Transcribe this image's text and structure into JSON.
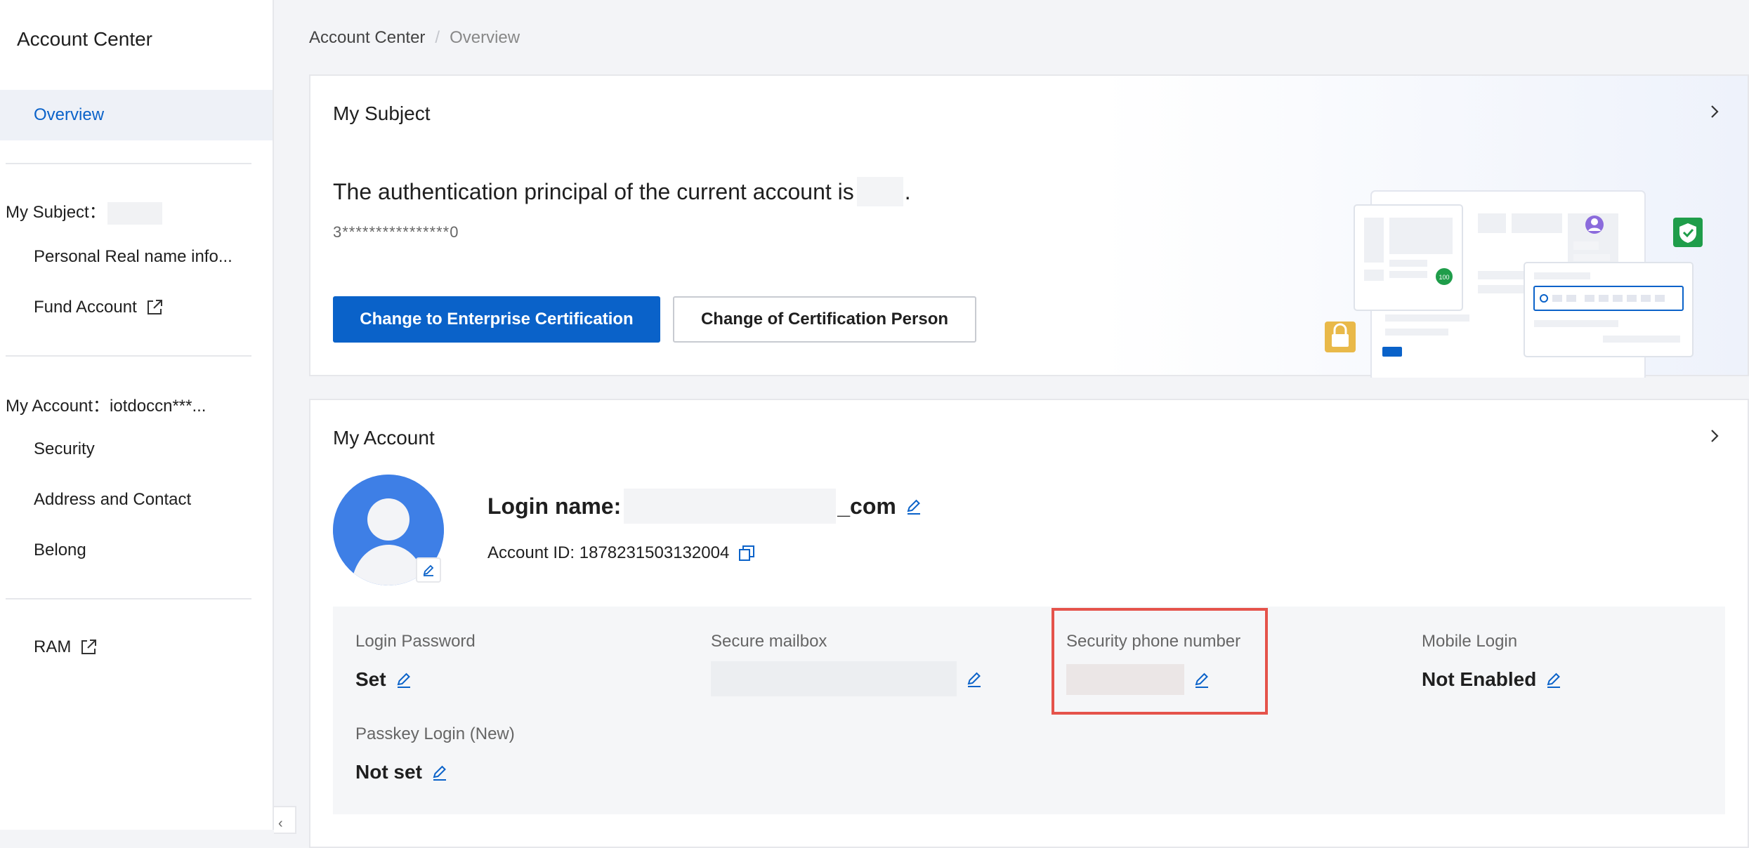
{
  "sidebar": {
    "title": "Account Center",
    "active_item": "Overview",
    "subject_group": "My Subject：",
    "subject_items": [
      "Personal Real name info...",
      "Fund Account"
    ],
    "account_group": "My Account：iotdoccn***...",
    "account_items": [
      "Security",
      "Address and Contact",
      "Belong"
    ],
    "ram_label": "RAM",
    "collapse_glyph": "‹"
  },
  "breadcrumb": {
    "root": "Account Center",
    "separator": "/",
    "current": "Overview"
  },
  "subject_card": {
    "title": "My Subject",
    "principal_prefix": "The authentication principal of the current account is",
    "principal_suffix": ".",
    "masked_id": "3****************0",
    "primary_button": "Change to Enterprise Certification",
    "secondary_button": "Change of Certification Person",
    "illustration_badge": "100"
  },
  "account_card": {
    "title": "My Account",
    "login_label": "Login name:",
    "login_suffix": "_com",
    "account_id_label": "Account ID: 1878231503132004",
    "fields": {
      "login_password": {
        "label": "Login Password",
        "value": "Set"
      },
      "secure_mailbox": {
        "label": "Secure mailbox",
        "value": ""
      },
      "security_phone": {
        "label": "Security phone number",
        "value": ""
      },
      "mobile_login": {
        "label": "Mobile Login",
        "value": "Not Enabled"
      },
      "passkey_login": {
        "label": "Passkey Login (New)",
        "value": "Not set"
      }
    }
  },
  "colors": {
    "accent": "#0a62c9",
    "highlight_box": "#e5534b",
    "avatar_bg": "#3e7fe6",
    "shield_green": "#1f9d4a",
    "lock_yellow": "#e9b949"
  },
  "icons": [
    "external-link-icon",
    "chevron-right-icon",
    "edit-icon",
    "copy-icon",
    "avatar-placeholder-icon",
    "shield-check-icon",
    "lock-icon",
    "user-circle-icon"
  ]
}
